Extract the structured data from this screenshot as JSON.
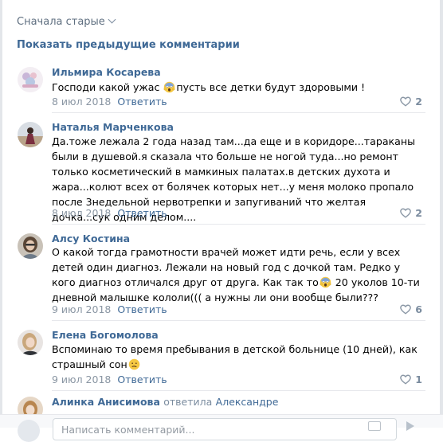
{
  "sort_label": "Сначала старые",
  "show_previous": "Показать предыдущие комментарии",
  "reply_label": "Ответить",
  "comments": [
    {
      "author": "Ильмира Косарева",
      "text_before": "Господи какой ужас ",
      "emoji": "scream-emoji",
      "text_after": "пусть все детки будут здоровыми !",
      "date": "8 июл 2018",
      "likes": "2"
    },
    {
      "author": "Наталья Марченкова",
      "text": "Да.тоже лежала 2 года назад там...да еще и в коридоре...тараканы были в душевой.я сказала что больше не ногой туда...но ремонт только косметический в мамкиных палатах.в детских духота и жара...колют всех от болячек которых нет...у меня молоко пропало после 3недельной нервотрепки и запугиваний что желтая дочка...сук одним делом....",
      "date": "8 июл 2018",
      "likes": "2"
    },
    {
      "author": "Алсу Костина",
      "text_before": "О какой тогда грамотности врачей может идти речь, если у всех детей один диагноз. Лежали на новый год с дочкой там. Редко у кого диагноз отличался друг от друга. Как так то",
      "emoji": "scream-emoji",
      "text_after": " 20 уколов 10-ти дневной малышке кололи((( а нужны ли они вообще были???",
      "date": "9 июл 2018",
      "likes": "6"
    },
    {
      "author": "Елена Богомолова",
      "text_before": "Вспоминаю то время пребывания в детской больнице (10 дней), как страшный сон",
      "emoji": "confused-emoji",
      "text_after": "",
      "date": "9 июл 2018",
      "likes": "1"
    },
    {
      "author": "Алинка Анисимова",
      "reply_word": "ответила",
      "reply_target": "Александре"
    }
  ],
  "composer": {
    "placeholder": "Написать комментарий..."
  },
  "colors": {
    "link": "#3f6996",
    "meta": "#8a96a3",
    "likes": "#7b8c9f",
    "divider": "#e7e8ec"
  }
}
